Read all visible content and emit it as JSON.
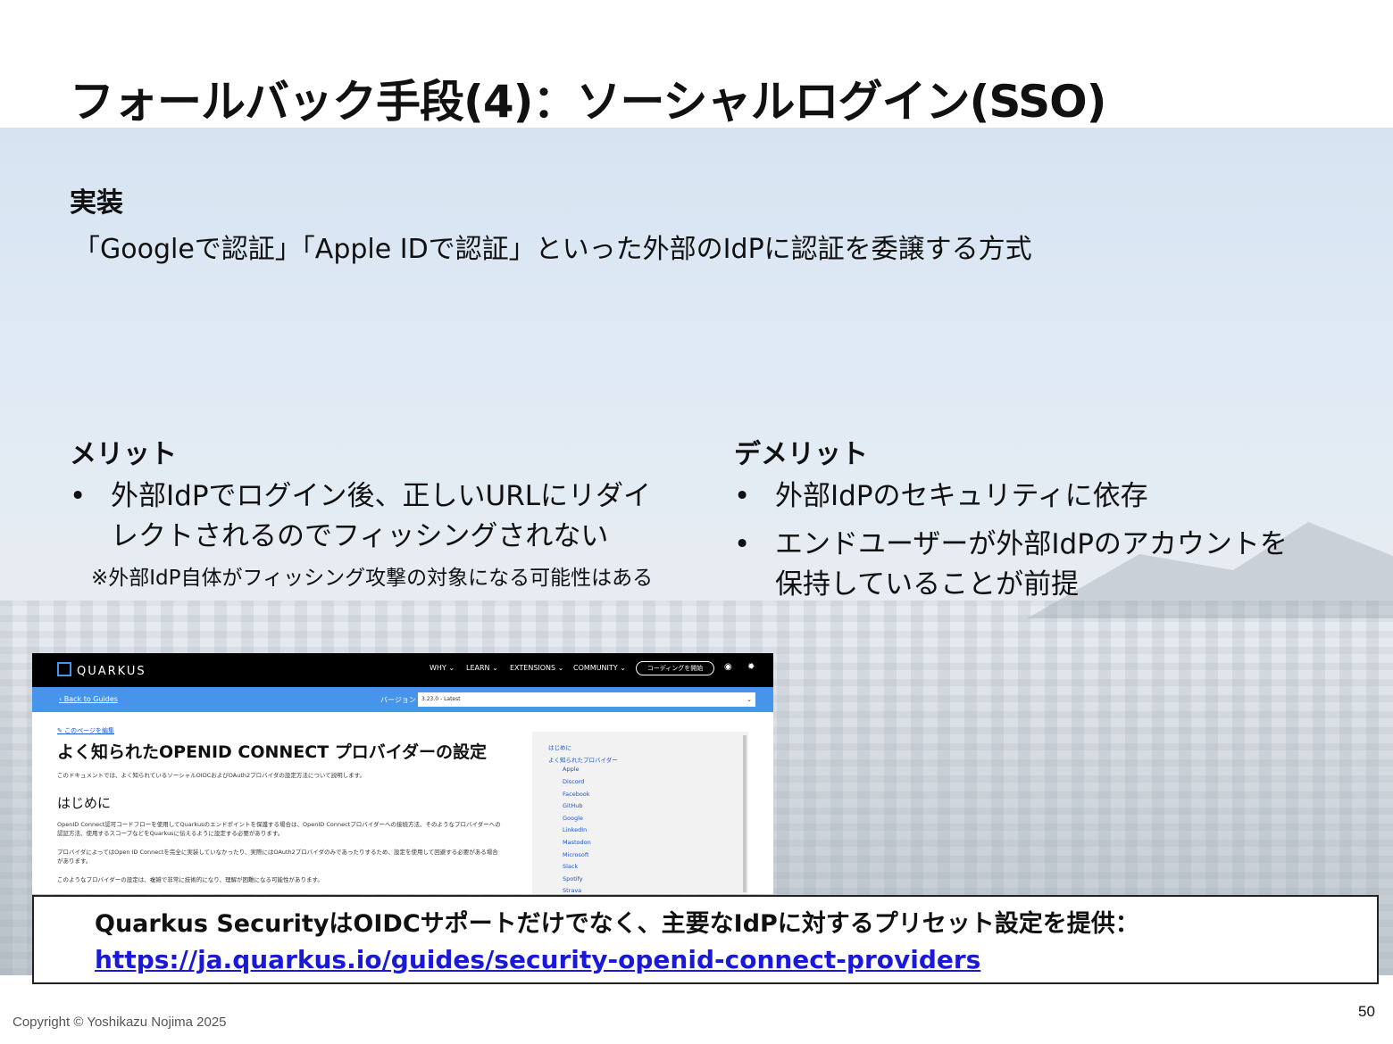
{
  "slide": {
    "title": "フォールバック手段(4)：ソーシャルログイン(SSO)",
    "impl_heading": "実装",
    "impl_text": "「Googleで認証」「Apple IDで認証」といった外部のIdPに認証を委譲する方式",
    "merit_heading": "メリット",
    "merit_bullets": [
      {
        "line1": "外部IdPでログイン後、正しいURLにリダイ",
        "line2": "レクトされるのでフィッシングされない"
      }
    ],
    "merit_note": "※外部IdP自体がフィッシング攻撃の対象になる可能性はある",
    "demerit_heading": "デメリット",
    "demerit_bullets": [
      {
        "line1": "外部IdPのセキュリティに依存"
      },
      {
        "line1": "エンドユーザーが外部IdPのアカウントを",
        "line2": "保持していることが前提"
      }
    ],
    "bullet_char": "•",
    "callout": {
      "line1": "Quarkus SecurityはOIDCサポートだけでなく、主要なIdPに対するプリセット設定を提供：",
      "link": "https://ja.quarkus.io/guides/security-openid-connect-providers"
    },
    "copyright": "Copyright © Yoshikazu Nojima 2025",
    "page_number": "50"
  },
  "screenshot": {
    "logo": "QUARKUS",
    "menu": [
      "WHY",
      "LEARN",
      "EXTENSIONS",
      "COMMUNITY"
    ],
    "cta_button": "コーディングを開始",
    "back_link": "Back to Guides",
    "version_label": "バージョン",
    "version_value": "3.23.0 - Latest",
    "edit_link": "このページを編集",
    "heading": "よく知られたOPENID CONNECT プロバイダーの設定",
    "intro": "このドキュメントでは、よく知られているソーシャルOIDCおよびOAuth2プロバイダの設定方法について説明します。",
    "section_heading": "はじめに",
    "para1a": "OpenID Connect認可コードフローを使用してQuarkusのエンドポイントを保護する場合は、OpenID Connectプロバイダーへの接続方法、そのようなプロバイダーへの",
    "para1b": "認証方法、使用するスコープなどをQuarkusに伝えるように設定する必要があります。",
    "para2a": "プロバイダによってはOpen ID Connectを完全に実装していなかったり、実際にはOAuth2プロバイダのみであったりするため、設定を使用して回避する必要がある場合",
    "para2b": "があります。",
    "para3": "このようなプロバイダーの設定は、複雑で非常に技術的になり、理解が困難になる可能性があります。",
    "toc": [
      "はじめに",
      "よく知られたプロバイダー",
      "Apple",
      "Discord",
      "Facebook",
      "GitHub",
      "Google",
      "LinkedIn",
      "Mastodon",
      "Microsoft",
      "Slack",
      "Spotify",
      "Strava"
    ]
  }
}
